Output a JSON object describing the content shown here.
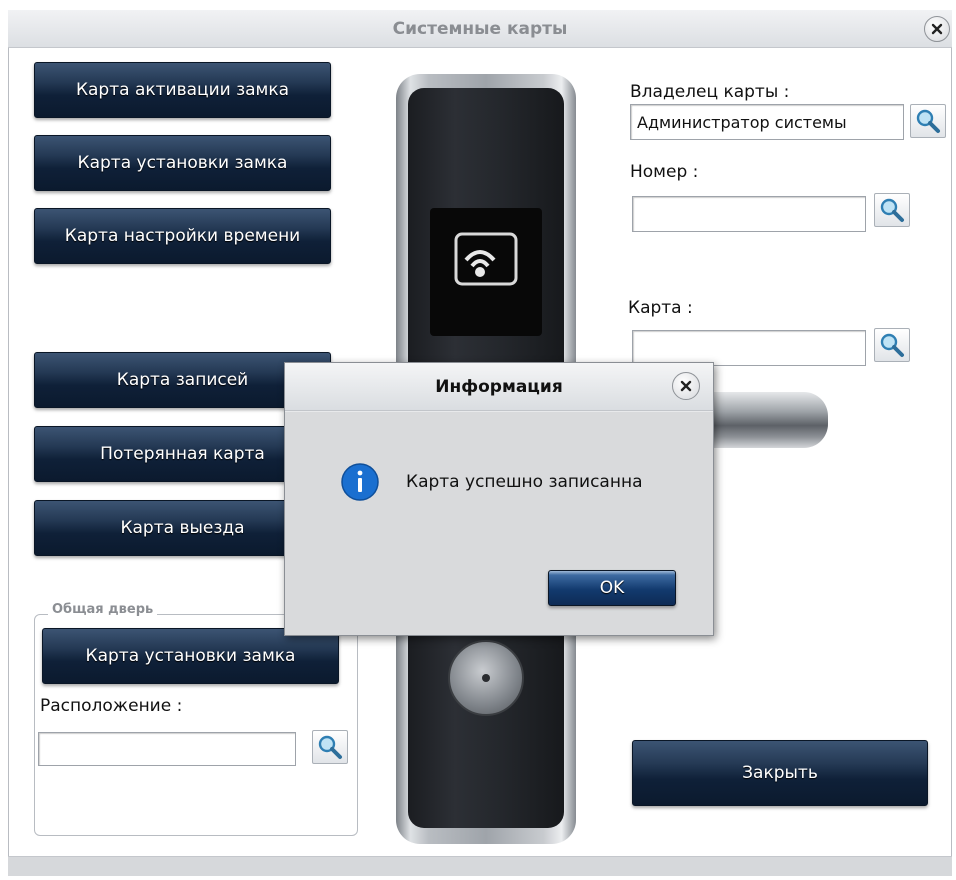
{
  "window": {
    "title": "Системные карты"
  },
  "left_buttons": {
    "activation": "Карта активации замка",
    "install": "Карта установки замка",
    "time": "Карта настройки времени",
    "records": "Карта записей",
    "lost": "Потерянная карта",
    "checkout": "Карта выезда"
  },
  "group": {
    "label": "Общая дверь",
    "install_button": "Карта установки замка",
    "location_label": "Расположение :",
    "location_value": ""
  },
  "right": {
    "owner_label": "Владелец карты :",
    "owner_value": "Администратор системы",
    "number_label": "Номер :",
    "number_value": "",
    "card_label": "Карта :",
    "card_value": ""
  },
  "close_button": "Закрыть",
  "dialog": {
    "title": "Информация",
    "message": "Карта успешно записанна",
    "ok_label": "OK"
  },
  "icons": {
    "search": "search-icon",
    "close": "close-icon",
    "info": "info-icon",
    "lock_card_reader": "card-reader-icon"
  },
  "colors": {
    "button_dark": "#0f2038",
    "ok_button": "#123a6e",
    "info_blue": "#1a6fd0"
  }
}
